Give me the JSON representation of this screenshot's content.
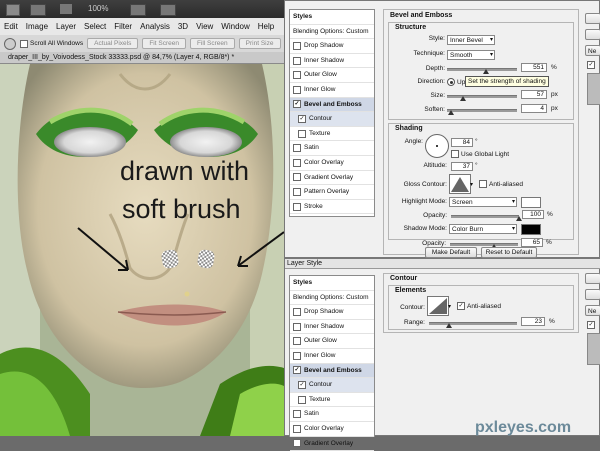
{
  "menu": {
    "items": [
      "Edit",
      "Image",
      "Layer",
      "Select",
      "Filter",
      "Analysis",
      "3D",
      "View",
      "Window",
      "Help"
    ]
  },
  "topbar": {
    "zoom": "100%"
  },
  "options_bar": {
    "scroll_all": "Scroll All Windows",
    "actual_pixels": "Actual Pixels",
    "fit_screen": "Fit Screen",
    "fill_screen": "Fill Screen",
    "print_size": "Print Size"
  },
  "document": {
    "tab_title": "draper_III_by_Voivodess_Stock   33333.psd @ 84,7% (Layer 4, RGB/8*) *"
  },
  "canvas": {
    "annotation_line1": "drawn with",
    "annotation_line2": "soft brush"
  },
  "dialog_top": {
    "styles_header": "Styles",
    "items": [
      {
        "label": "Blending Options: Custom",
        "check": false,
        "kind": "header"
      },
      {
        "label": "Drop Shadow",
        "check": false,
        "kind": "item"
      },
      {
        "label": "Inner Shadow",
        "check": false,
        "kind": "item"
      },
      {
        "label": "Outer Glow",
        "check": false,
        "kind": "item"
      },
      {
        "label": "Inner Glow",
        "check": false,
        "kind": "item"
      },
      {
        "label": "Bevel and Emboss",
        "check": true,
        "kind": "selected"
      },
      {
        "label": "Contour",
        "check": true,
        "kind": "subsel"
      },
      {
        "label": "Texture",
        "check": false,
        "kind": "sub"
      },
      {
        "label": "Satin",
        "check": false,
        "kind": "item"
      },
      {
        "label": "Color Overlay",
        "check": false,
        "kind": "item"
      },
      {
        "label": "Gradient Overlay",
        "check": false,
        "kind": "item"
      },
      {
        "label": "Pattern Overlay",
        "check": false,
        "kind": "item"
      },
      {
        "label": "Stroke",
        "check": false,
        "kind": "item"
      }
    ],
    "section_title": "Bevel and Emboss",
    "structure": {
      "title": "Structure",
      "style_label": "Style:",
      "style_value": "Inner Bevel",
      "technique_label": "Technique:",
      "technique_value": "Smooth",
      "depth_label": "Depth:",
      "depth_value": "551",
      "depth_unit": "%",
      "depth_level": 0.55,
      "direction_label": "Direction:",
      "direction_up": "Up",
      "tooltip": "Set the strength of shading",
      "size_label": "Size:",
      "size_value": "57",
      "size_unit": "px",
      "size_level": 0.23,
      "soften_label": "Soften:",
      "soften_value": "4",
      "soften_unit": "px",
      "soften_level": 0.05
    },
    "shading": {
      "title": "Shading",
      "angle_label": "Angle:",
      "angle_value": "84",
      "angle_unit": "°",
      "global_light": "Use Global Light",
      "altitude_label": "Altitude:",
      "altitude_value": "37",
      "altitude_unit": "°",
      "gloss_label": "Gloss Contour:",
      "anti_aliased": "Anti-aliased",
      "highlight_label": "Highlight Mode:",
      "highlight_value": "Screen",
      "highlight_color": "#ffffff",
      "opacity1_label": "Opacity:",
      "opacity1_value": "100",
      "opacity1_level": 1.0,
      "shadow_label": "Shadow Mode:",
      "shadow_value": "Color Burn",
      "shadow_color": "#000000",
      "opacity2_label": "Opacity:",
      "opacity2_value": "65",
      "opacity2_level": 0.65,
      "pct": "%"
    },
    "make_default": "Make Default",
    "reset_default": "Reset to Default"
  },
  "dialog_bottom": {
    "window_title": "Layer Style",
    "styles_header": "Styles",
    "items": [
      {
        "label": "Blending Options: Custom",
        "check": false,
        "kind": "header"
      },
      {
        "label": "Drop Shadow",
        "check": false,
        "kind": "item"
      },
      {
        "label": "Inner Shadow",
        "check": false,
        "kind": "item"
      },
      {
        "label": "Outer Glow",
        "check": false,
        "kind": "item"
      },
      {
        "label": "Inner Glow",
        "check": false,
        "kind": "item"
      },
      {
        "label": "Bevel and Emboss",
        "check": true,
        "kind": "selected"
      },
      {
        "label": "Contour",
        "check": true,
        "kind": "subsel"
      },
      {
        "label": "Texture",
        "check": false,
        "kind": "sub"
      },
      {
        "label": "Satin",
        "check": false,
        "kind": "item"
      },
      {
        "label": "Color Overlay",
        "check": false,
        "kind": "item"
      },
      {
        "label": "Gradient Overlay",
        "check": false,
        "kind": "item"
      }
    ],
    "section_title": "Contour",
    "elements_title": "Elements",
    "contour_label": "Contour:",
    "anti_aliased": "Anti-aliased",
    "range_label": "Range:",
    "range_value": "23",
    "range_unit": "%",
    "range_level": 0.23
  },
  "right_buttons": {
    "new_label": "Ne"
  },
  "watermark": "pxleyes.com"
}
